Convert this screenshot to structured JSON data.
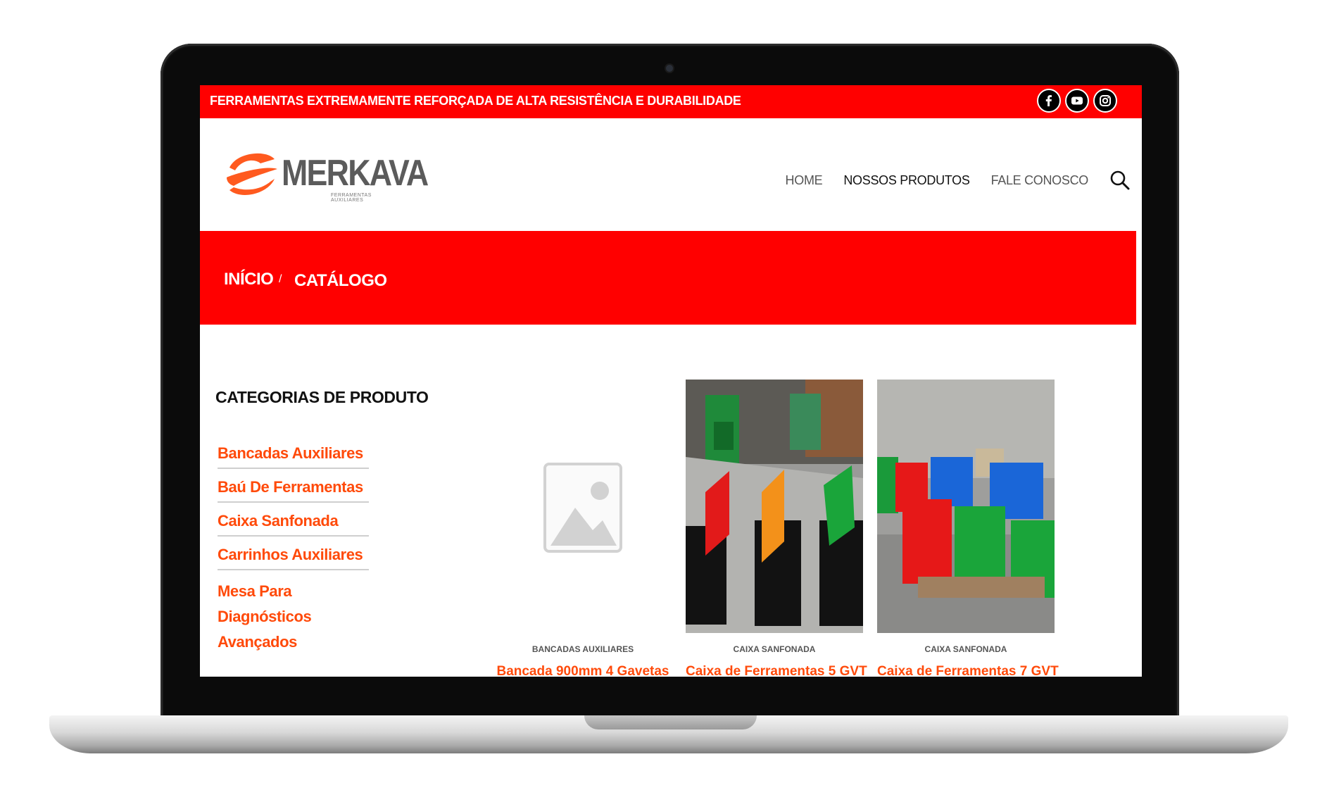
{
  "topbar": {
    "message": "FERRAMENTAS EXTREMAMENTE REFORÇADA DE ALTA RESISTÊNCIA E DURABILIDADE",
    "social": [
      "facebook-icon",
      "youtube-icon",
      "instagram-icon"
    ]
  },
  "header": {
    "logo_text": "MERKAVA",
    "logo_tagline": "FERRAMENTAS AUXILIARES",
    "nav": {
      "home": "HOME",
      "produtos": "NOSSOS PRODUTOS",
      "fale": "FALE CONOSCO"
    }
  },
  "breadcrumb": {
    "inicio": "INÍCIO",
    "separator": "/",
    "current": "CATÁLOGO"
  },
  "sidebar": {
    "title": "CATEGORIAS DE PRODUTO",
    "items": [
      "Bancadas Auxiliares",
      "Baú De Ferramentas",
      "Caixa Sanfonada",
      "Carrinhos Auxiliares",
      "Mesa Para Diagnósticos Avançados"
    ]
  },
  "products": [
    {
      "category": "BANCADAS AUXILIARES",
      "title": "Bancada 900mm 4 Gavetas",
      "image": "placeholder-icon"
    },
    {
      "category": "CAIXA SANFONADA",
      "title": "Caixa de Ferramentas 5 GVT",
      "image": "toolbox-photo"
    },
    {
      "category": "CAIXA SANFONADA",
      "title": "Caixa de Ferramentas 7 GVT",
      "image": "toolbox-photo"
    }
  ],
  "colors": {
    "brand_red": "#ff0000",
    "link_orange": "#ff4a0a"
  }
}
